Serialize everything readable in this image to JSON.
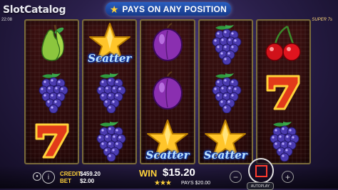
{
  "watermark": "SlotCatalog",
  "clock": "22:08",
  "header": {
    "banner_text": "PAYS ON ANY POSITION",
    "game_name": "SUPER 7s"
  },
  "scatter_text": "Scatter",
  "reels": [
    [
      "pear",
      "grapes",
      "seven"
    ],
    [
      "scatter",
      "grapes",
      "grapes"
    ],
    [
      "plum",
      "plum",
      "scatter"
    ],
    [
      "grapes",
      "grapes",
      "scatter"
    ],
    [
      "cherries",
      "seven",
      "grapes"
    ]
  ],
  "footer": {
    "credit_label": "CREDIT",
    "credit_value": "$459.20",
    "bet_label": "BET",
    "bet_value": "$2.00",
    "win_label": "WIN",
    "win_value": "$15.20",
    "pays_text": "PAYS $20.00",
    "autoplay_label": "AUTOPLAY",
    "minus": "−",
    "plus": "+",
    "info": "i"
  },
  "colors": {
    "gold": "#ffd23a",
    "reel_bg": "#2a0a0a",
    "spin_accent": "#ff3b2e",
    "banner": "#2a5fc0"
  }
}
